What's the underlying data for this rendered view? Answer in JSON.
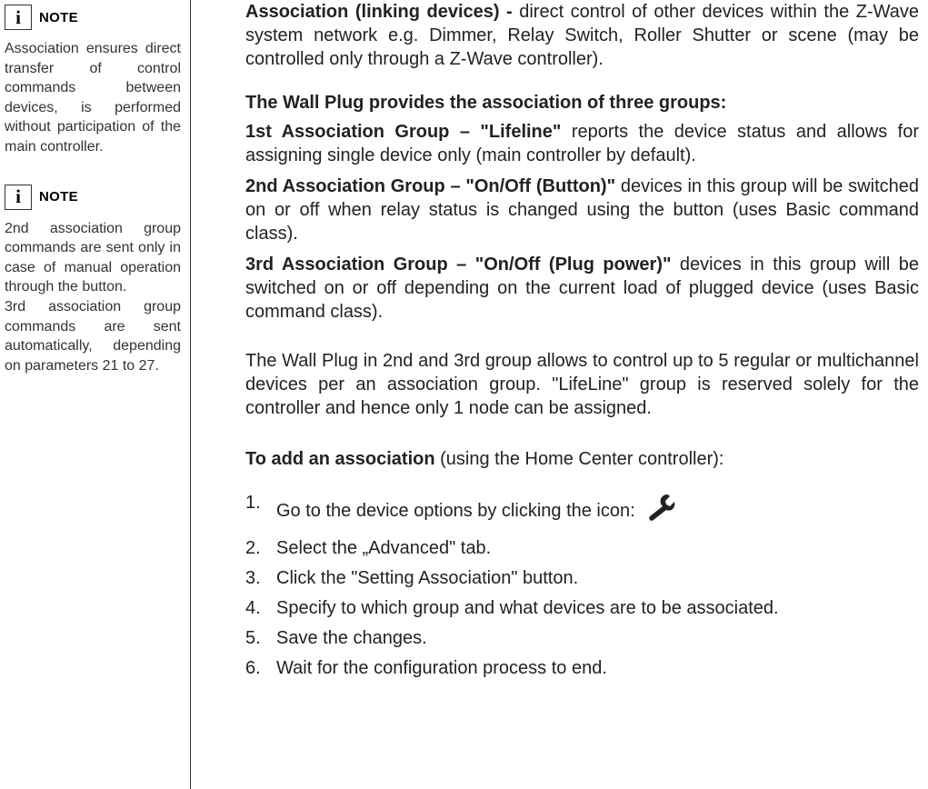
{
  "sidebar": {
    "note1": {
      "icon": "i",
      "label": "NOTE",
      "text": "Association ensures direct transfer of control commands between devices, is performed without participation of the main controller."
    },
    "note2": {
      "icon": "i",
      "label": "NOTE",
      "text_part1": "2nd association group commands are sent only in case of manual operation through the button.",
      "text_part2": "3rd association group commands are sent automatically, depending on parameters 21 to 27."
    }
  },
  "main": {
    "intro": {
      "bold": "Association (linking devices) -",
      "rest": " direct control of other devices within the Z-Wave system network e.g. Dimmer, Relay Switch, Roller Shutter or scene (may be controlled only through a Z-Wave controller)."
    },
    "groups_title": "The Wall Plug provides the association of three groups:",
    "group1": {
      "bold": "1st Association Group – \"Lifeline\"",
      "rest": " reports the device status and allows for assigning single device only (main controller by default)."
    },
    "group2": {
      "bold": "2nd Association Group –  \"On/Off (Button)\"",
      "rest": " devices in this group will be switched on or off when relay status is changed using the button (uses Basic command class)."
    },
    "group3": {
      "bold": "3rd Association Group – \"On/Off (Plug power)\"",
      "rest": " devices in this group will be switched on or off depending on the current load of plugged device (uses Basic command class)."
    },
    "control_text": "The Wall Plug in 2nd and 3rd group allows to control up to 5 regular or multichannel devices per an association group. \"LifeLine\" group is reserved solely for the controller and hence only 1 node can  be assigned.",
    "add_assoc": {
      "bold": "To add an association",
      "rest": " (using the Home Center controller):"
    },
    "steps": [
      "Go to the device options by clicking the icon:",
      "Select the „Advanced\" tab.",
      "Click the \"Setting Association\" button.",
      "Specify to which group and what devices are to be associated.",
      "Save the changes.",
      "Wait for the configuration process to end."
    ]
  }
}
